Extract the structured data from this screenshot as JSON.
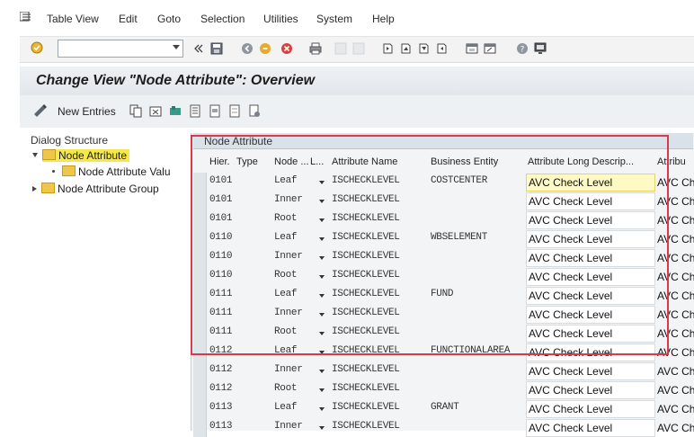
{
  "menu": {
    "items": [
      "Table View",
      "Edit",
      "Goto",
      "Selection",
      "Utilities",
      "System",
      "Help"
    ]
  },
  "toolbar": {
    "command_field_value": ""
  },
  "title": "Change View \"Node Attribute\": Overview",
  "app_toolbar": {
    "new_entries_label": "New Entries"
  },
  "dialog_structure": {
    "title": "Dialog Structure",
    "items": [
      {
        "label": "Node Attribute",
        "level": 0,
        "selected": true
      },
      {
        "label": "Node Attribute Valu",
        "level": 1,
        "selected": false
      },
      {
        "label": "Node Attribute Group",
        "level": 0,
        "selected": false
      }
    ]
  },
  "table": {
    "caption": "Node Attribute",
    "columns": [
      "Hier.",
      "Type",
      "Node ...",
      "L...",
      "Attribute Name",
      "Business Entity",
      "Attribute Long Descrip...",
      "Attribu"
    ],
    "rows": [
      {
        "hier": "0101",
        "node": "Leaf",
        "attr": "ISCHECKLEVEL",
        "entity": "COSTCENTER",
        "desc": "AVC Check Level",
        "next": "AVC Ch",
        "hl": true
      },
      {
        "hier": "0101",
        "node": "Inner",
        "attr": "ISCHECKLEVEL",
        "entity": "",
        "desc": "AVC Check Level",
        "next": "AVC Ch"
      },
      {
        "hier": "0101",
        "node": "Root",
        "attr": "ISCHECKLEVEL",
        "entity": "",
        "desc": "AVC Check Level",
        "next": "AVC Ch"
      },
      {
        "hier": "0110",
        "node": "Leaf",
        "attr": "ISCHECKLEVEL",
        "entity": "WBSELEMENT",
        "desc": "AVC Check Level",
        "next": "AVC Ch"
      },
      {
        "hier": "0110",
        "node": "Inner",
        "attr": "ISCHECKLEVEL",
        "entity": "",
        "desc": "AVC Check Level",
        "next": "AVC Ch"
      },
      {
        "hier": "0110",
        "node": "Root",
        "attr": "ISCHECKLEVEL",
        "entity": "",
        "desc": "AVC Check Level",
        "next": "AVC Ch"
      },
      {
        "hier": "0111",
        "node": "Leaf",
        "attr": "ISCHECKLEVEL",
        "entity": "FUND",
        "desc": "AVC Check Level",
        "next": "AVC Ch"
      },
      {
        "hier": "0111",
        "node": "Inner",
        "attr": "ISCHECKLEVEL",
        "entity": "",
        "desc": "AVC Check Level",
        "next": "AVC Ch"
      },
      {
        "hier": "0111",
        "node": "Root",
        "attr": "ISCHECKLEVEL",
        "entity": "",
        "desc": "AVC Check Level",
        "next": "AVC Ch"
      },
      {
        "hier": "0112",
        "node": "Leaf",
        "attr": "ISCHECKLEVEL",
        "entity": "FUNCTIONALAREA",
        "desc": "AVC Check Level",
        "next": "AVC Ch"
      },
      {
        "hier": "0112",
        "node": "Inner",
        "attr": "ISCHECKLEVEL",
        "entity": "",
        "desc": "AVC Check Level",
        "next": "AVC Ch"
      },
      {
        "hier": "0112",
        "node": "Root",
        "attr": "ISCHECKLEVEL",
        "entity": "",
        "desc": "AVC Check Level",
        "next": "AVC Ch"
      },
      {
        "hier": "0113",
        "node": "Leaf",
        "attr": "ISCHECKLEVEL",
        "entity": "GRANT",
        "desc": "AVC Check Level",
        "next": "AVC Ch"
      },
      {
        "hier": "0113",
        "node": "Inner",
        "attr": "ISCHECKLEVEL",
        "entity": "",
        "desc": "AVC Check Level",
        "next": "AVC Ch"
      }
    ]
  },
  "icons": {
    "menu": "menu-icon",
    "enter": "enter-check-icon",
    "save": "save-icon",
    "new_entries": "new-entries-pencil-icon"
  },
  "colors": {
    "selection_yellow": "#f5e84a",
    "highlight_frame": "#d9394b"
  }
}
